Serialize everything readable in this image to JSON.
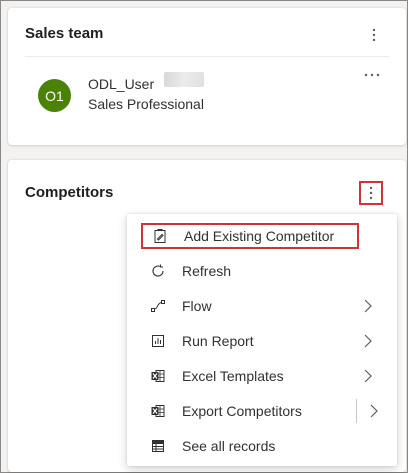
{
  "sales_team": {
    "title": "Sales team",
    "more_icon": "vertical-ellipsis-icon",
    "member": {
      "initials": "O1",
      "name": "ODL_User",
      "role": "Sales Professional",
      "avatar_color": "#498205",
      "more_icon": "horizontal-ellipsis-icon"
    }
  },
  "competitors": {
    "title": "Competitors",
    "more_icon": "vertical-ellipsis-icon"
  },
  "menu": {
    "items": [
      {
        "label": "Add Existing Competitor",
        "icon": "add-existing-icon"
      },
      {
        "label": "Refresh",
        "icon": "refresh-icon"
      },
      {
        "label": "Flow",
        "icon": "flow-icon",
        "submenu": true
      },
      {
        "label": "Run Report",
        "icon": "report-icon",
        "submenu": true
      },
      {
        "label": "Excel Templates",
        "icon": "excel-icon",
        "submenu": true
      },
      {
        "label": "Export Competitors",
        "icon": "export-excel-icon",
        "split": true
      },
      {
        "label": "See all records",
        "icon": "grid-icon"
      }
    ]
  },
  "colors": {
    "highlight_border": "#d13438",
    "text": "#323130"
  }
}
